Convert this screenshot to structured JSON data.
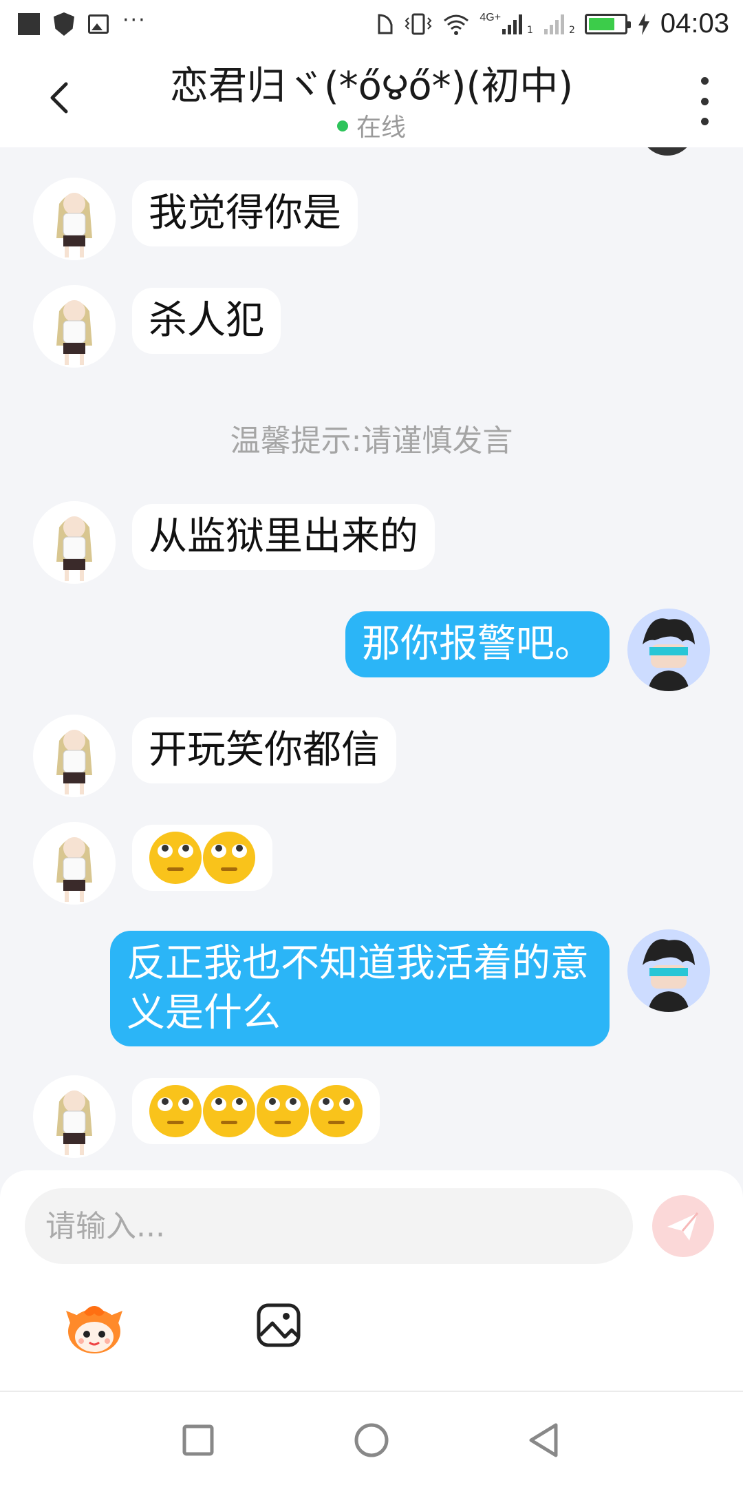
{
  "status_bar": {
    "time": "04:03",
    "network": "4G+",
    "sim1": "1",
    "sim2": "2",
    "battery_level": 0.75,
    "battery_color": "#3ccc4a"
  },
  "header": {
    "title": "恋君归ヾ(*ő౪ő*)(初中)",
    "status": "在线",
    "status_color": "#2ec45b"
  },
  "messages": [
    {
      "side": "in",
      "text": " 我觉得你是"
    },
    {
      "side": "in",
      "text": "杀人犯"
    },
    {
      "side": "notice",
      "text": "温馨提示:请谨慎发言"
    },
    {
      "side": "in",
      "text": "从监狱里出来的"
    },
    {
      "side": "out",
      "text": "那你报警吧。"
    },
    {
      "side": "in",
      "text": "开玩笑你都信"
    },
    {
      "side": "in",
      "emoji": [
        "face-with-rolling-eyes",
        "face-with-rolling-eyes"
      ]
    },
    {
      "side": "out",
      "text": "反正我也不知道我活着的意义是什么"
    },
    {
      "side": "in",
      "emoji": [
        "face-with-rolling-eyes",
        "face-with-rolling-eyes",
        "face-with-rolling-eyes",
        "face-with-rolling-eyes"
      ]
    }
  ],
  "input": {
    "placeholder": "请输入..."
  },
  "colors": {
    "bubble_out": "#2bb5f7",
    "bubble_in": "#ffffff",
    "background": "#f4f5f8",
    "send_button": "#f5a3a3"
  },
  "icons": {
    "back": "chevron-left-icon",
    "more": "more-vertical-icon",
    "send": "paper-plane-icon",
    "emoji": "emoji-mascot-icon",
    "image": "image-icon",
    "nav_recent": "square-icon",
    "nav_home": "circle-icon",
    "nav_back": "triangle-icon"
  }
}
